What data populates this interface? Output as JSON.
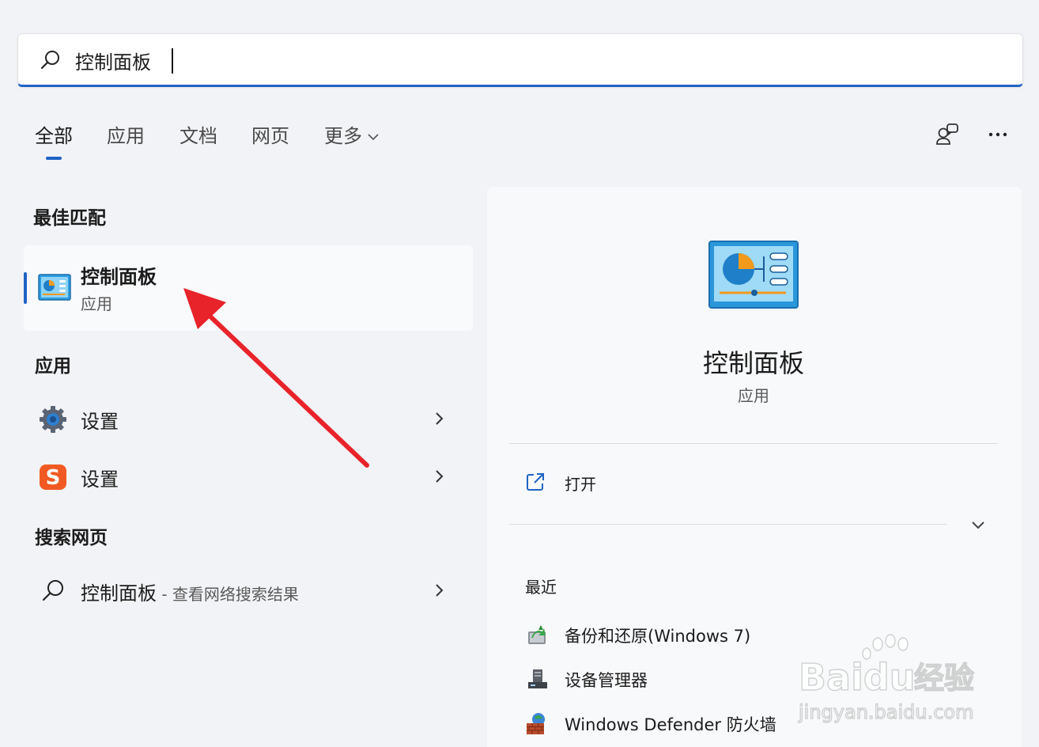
{
  "search": {
    "value": "控制面板",
    "placeholder": ""
  },
  "tabs": [
    {
      "label": "全部",
      "active": true
    },
    {
      "label": "应用"
    },
    {
      "label": "文档"
    },
    {
      "label": "网页"
    },
    {
      "label": "更多"
    }
  ],
  "toolbar": {
    "account_icon": "people-icon",
    "more_icon": "more-icon"
  },
  "best_match": {
    "title": "最佳匹配",
    "item": {
      "name": "控制面板",
      "type": "应用",
      "icon": "control-panel-icon"
    }
  },
  "apps": {
    "title": "应用",
    "items": [
      {
        "label": "设置",
        "icon": "gear-icon"
      },
      {
        "label": "设置",
        "icon": "sogou-icon"
      }
    ]
  },
  "web": {
    "title": "搜索网页",
    "item": {
      "label": "控制面板",
      "suffix": " - 查看网络搜索结果",
      "icon": "search-icon"
    }
  },
  "detail": {
    "name": "控制面板",
    "type": "应用",
    "open_label": "打开",
    "recent_title": "最近",
    "recent": [
      {
        "label": "备份和还原(Windows 7)",
        "icon": "backup-icon"
      },
      {
        "label": "设备管理器",
        "icon": "device-manager-icon"
      },
      {
        "label": "Windows Defender 防火墙",
        "icon": "firewall-icon"
      }
    ]
  },
  "watermark": {
    "brand": "Baidu",
    "brand_cn": "经验",
    "url": "jingyan.baidu.com"
  },
  "colors": {
    "accent": "#1f63c4",
    "background": "#f2f3f6",
    "annotation": "#e8232a"
  }
}
